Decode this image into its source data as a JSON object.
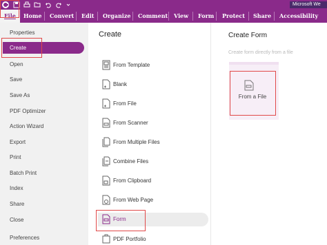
{
  "app_title": "Microsoft We",
  "quick_access": [
    "app-logo-icon",
    "save-icon",
    "print-icon",
    "open-icon",
    "undo-icon",
    "redo-icon",
    "customize-icon"
  ],
  "ribbon_tabs": [
    {
      "label": "File",
      "active": true
    },
    {
      "label": "Home"
    },
    {
      "label": "Convert"
    },
    {
      "label": "Edit"
    },
    {
      "label": "Organize"
    },
    {
      "label": "Comment"
    },
    {
      "label": "View"
    },
    {
      "label": "Form"
    },
    {
      "label": "Protect"
    },
    {
      "label": "Share"
    },
    {
      "label": "Accessibility"
    }
  ],
  "nav": {
    "items": [
      "Properties",
      "Create",
      "Open",
      "Save",
      "Save As",
      "PDF Optimizer",
      "Action Wizard",
      "Export",
      "Print",
      "Batch Print",
      "Index",
      "Share",
      "Close",
      "Preferences"
    ],
    "selected": "Create"
  },
  "create_panel": {
    "title": "Create",
    "options": [
      {
        "label": "From Template",
        "icon": "template-icon"
      },
      {
        "label": "Blank",
        "icon": "blank-page-icon"
      },
      {
        "label": "From File",
        "icon": "file-icon"
      },
      {
        "label": "From Scanner",
        "icon": "scanner-icon"
      },
      {
        "label": "From Multiple Files",
        "icon": "multiple-files-icon"
      },
      {
        "label": "Combine Files",
        "icon": "combine-files-icon"
      },
      {
        "label": "From Clipboard",
        "icon": "clipboard-icon"
      },
      {
        "label": "From Web Page",
        "icon": "web-page-icon"
      },
      {
        "label": "Form",
        "icon": "form-icon",
        "selected": true
      },
      {
        "label": "PDF Portfolio",
        "icon": "portfolio-icon"
      }
    ]
  },
  "form_panel": {
    "title": "Create Form",
    "subtitle": "Create form directly from a file",
    "card_label": "From a File",
    "card_icon": "form-file-icon"
  },
  "colors": {
    "accent": "#8a2a8a",
    "highlight_outline": "#e04848",
    "nav_background": "#f1f1f1",
    "card_background": "#f7eef7"
  }
}
